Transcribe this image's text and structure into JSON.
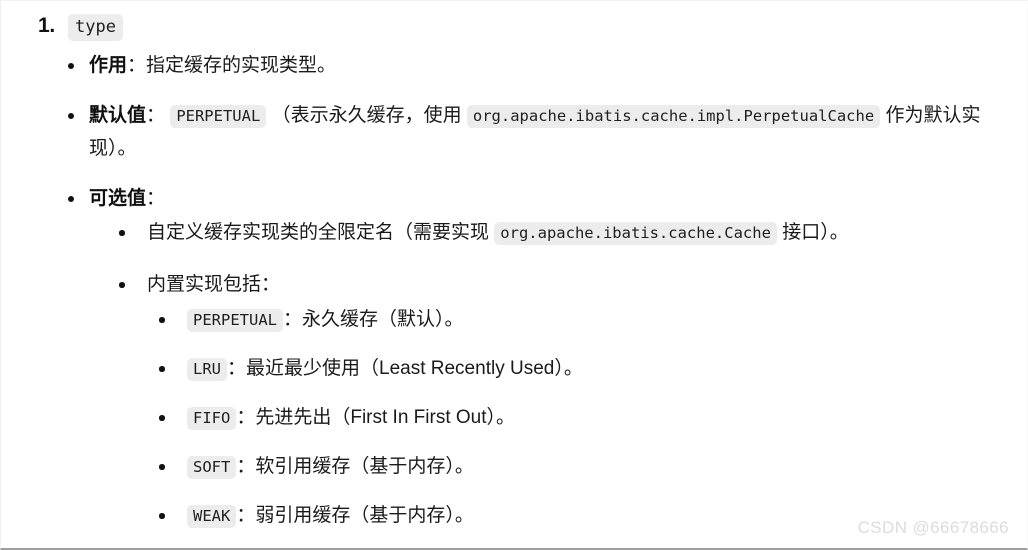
{
  "heading": {
    "marker": "1.",
    "code": "type"
  },
  "sections": [
    {
      "label": "作用",
      "colon": "：",
      "text": "指定缓存的实现类型。"
    },
    {
      "label": "默认值",
      "colon": "：",
      "code1": "PERPETUAL",
      "text_mid": "（表示永久缓存，使用",
      "code2": "org.apache.ibatis.cache.impl.PerpetualCache",
      "text_end": "作为默认实现）。"
    },
    {
      "label": "可选值",
      "colon": "："
    }
  ],
  "options": {
    "custom_impl": {
      "text_start": "自定义缓存实现类的全限定名（需要实现",
      "code": "org.apache.ibatis.cache.Cache",
      "text_end": "接口）。"
    },
    "builtin_label": "内置实现包括：",
    "builtin_items": [
      {
        "code": "PERPETUAL",
        "colon": "：",
        "desc": "永久缓存（默认）。"
      },
      {
        "code": "LRU",
        "colon": "：",
        "desc": "最近最少使用（Least Recently Used）。"
      },
      {
        "code": "FIFO",
        "colon": "：",
        "desc": "先进先出（First In First Out）。"
      },
      {
        "code": "SOFT",
        "colon": "：",
        "desc": "软引用缓存（基于内存）。"
      },
      {
        "code": "WEAK",
        "colon": "：",
        "desc": "弱引用缓存（基于内存）。"
      }
    ]
  },
  "watermark": "CSDN @66678666",
  "colors": {
    "page_background": "#ffffff",
    "text": "#1a1a1a",
    "code_background": "#ececec",
    "watermark": "#dcdcdc",
    "bottom_border": "#9e9e9e"
  }
}
